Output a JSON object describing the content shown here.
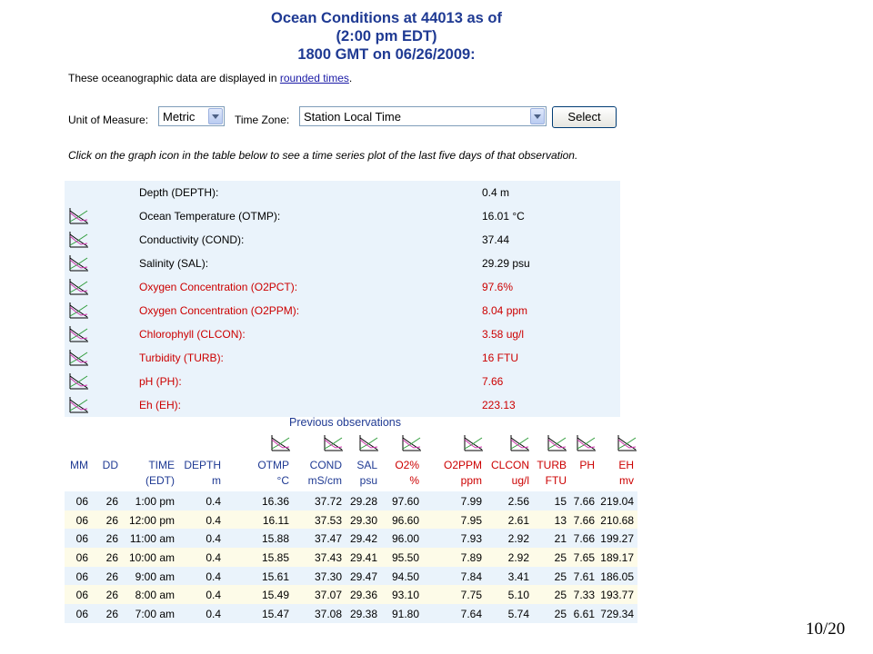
{
  "title": {
    "line1": "Ocean Conditions at 44013 as of",
    "line2": "(2:00 pm EDT)",
    "line3": "1800 GMT on 06/26/2009:"
  },
  "intro": {
    "text": "These oceanographic data are displayed in ",
    "link": "rounded times",
    "suffix": "."
  },
  "controls": {
    "unit_label": "Unit of Measure:",
    "unit_value": "Metric",
    "tz_label": "Time Zone:",
    "tz_value": "Station Local Time",
    "select_button": "Select"
  },
  "note": "Click on the graph icon in the table below to see a time series plot of the last five days of that observation.",
  "summary": [
    {
      "label": "Depth (DEPTH):",
      "value": "0.4 m",
      "icon": false,
      "red": false
    },
    {
      "label": "Ocean Temperature (OTMP):",
      "value": "16.01 °C",
      "icon": true,
      "red": false
    },
    {
      "label": "Conductivity (COND):",
      "value": "37.44",
      "icon": true,
      "red": false
    },
    {
      "label": "Salinity (SAL):",
      "value": "29.29 psu",
      "icon": true,
      "red": false
    },
    {
      "label": "Oxygen Concentration (O2PCT):",
      "value": "97.6%",
      "icon": true,
      "red": true
    },
    {
      "label": "Oxygen Concentration (O2PPM):",
      "value": "8.04 ppm",
      "icon": true,
      "red": true
    },
    {
      "label": "Chlorophyll (CLCON):",
      "value": "3.58 ug/l",
      "icon": true,
      "red": true
    },
    {
      "label": "Turbidity (TURB):",
      "value": "16 FTU",
      "icon": true,
      "red": true
    },
    {
      "label": "pH (PH):",
      "value": "7.66",
      "icon": true,
      "red": true
    },
    {
      "label": "Eh (EH):",
      "value": "223.13",
      "icon": true,
      "red": true
    }
  ],
  "previous": {
    "title": "Previous observations",
    "headers": {
      "mm": "MM",
      "dd": "DD",
      "time": "TIME",
      "time_unit": "(EDT)",
      "depth": "DEPTH",
      "depth_unit": "m",
      "otmp": "OTMP",
      "otmp_unit": "°C",
      "cond": "COND",
      "cond_unit": "mS/cm",
      "sal": "SAL",
      "sal_unit": "psu",
      "o2": "O2%",
      "o2_unit": "%",
      "o2ppm": "O2PPM",
      "o2ppm_unit": "ppm",
      "clcon": "CLCON",
      "clcon_unit": "ug/l",
      "turb": "TURB",
      "turb_unit": "FTU",
      "ph": "PH",
      "eh": "EH",
      "eh_unit": "mv"
    },
    "rows": [
      [
        "06",
        "26",
        "1:00 pm",
        "0.4",
        "16.36",
        "37.72",
        "29.28",
        "97.60",
        "7.99",
        "2.56",
        "15",
        "7.66",
        "219.04"
      ],
      [
        "06",
        "26",
        "12:00 pm",
        "0.4",
        "16.11",
        "37.53",
        "29.30",
        "96.60",
        "7.95",
        "2.61",
        "13",
        "7.66",
        "210.68"
      ],
      [
        "06",
        "26",
        "11:00 am",
        "0.4",
        "15.88",
        "37.47",
        "29.42",
        "96.00",
        "7.93",
        "2.92",
        "21",
        "7.66",
        "199.27"
      ],
      [
        "06",
        "26",
        "10:00 am",
        "0.4",
        "15.85",
        "37.43",
        "29.41",
        "95.50",
        "7.89",
        "2.92",
        "25",
        "7.65",
        "189.17"
      ],
      [
        "06",
        "26",
        "9:00 am",
        "0.4",
        "15.61",
        "37.30",
        "29.47",
        "94.50",
        "7.84",
        "3.41",
        "25",
        "7.61",
        "186.05"
      ],
      [
        "06",
        "26",
        "8:00 am",
        "0.4",
        "15.49",
        "37.07",
        "29.36",
        "93.10",
        "7.75",
        "5.10",
        "25",
        "7.33",
        "193.77"
      ],
      [
        "06",
        "26",
        "7:00 am",
        "0.4",
        "15.47",
        "37.08",
        "29.38",
        "91.80",
        "7.64",
        "5.74",
        "25",
        "6.61",
        "729.34"
      ]
    ]
  },
  "slide_number": "10/20"
}
